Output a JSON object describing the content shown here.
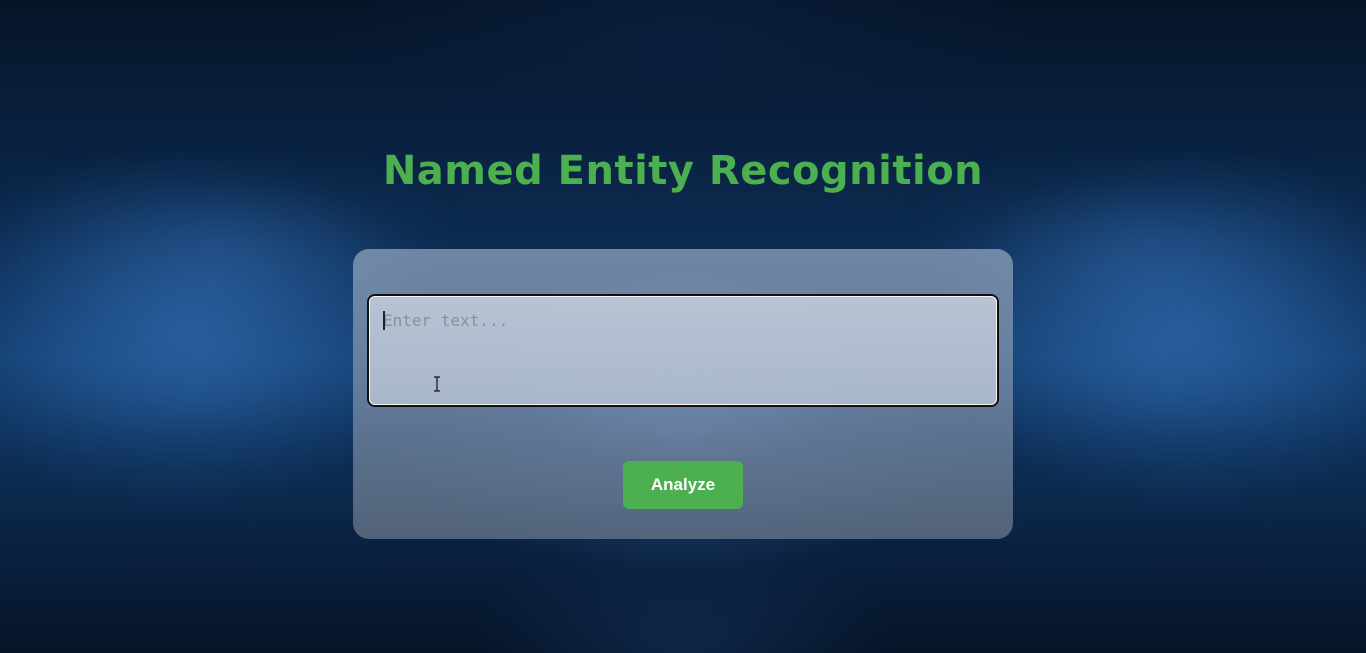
{
  "page": {
    "title": "Named Entity Recognition"
  },
  "form": {
    "input_placeholder": "Enter text...",
    "input_value": "",
    "analyze_label": "Analyze"
  },
  "colors": {
    "accent": "#4caf50",
    "button_text": "#ffffff"
  },
  "icons": {
    "pointer": "text-cursor-icon"
  }
}
